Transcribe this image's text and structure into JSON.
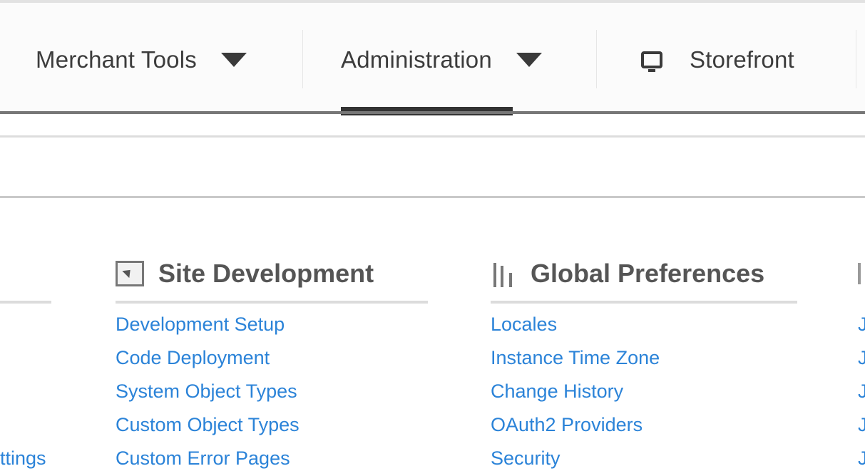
{
  "topnav": {
    "items": [
      {
        "label": "Merchant Tools"
      },
      {
        "label": "Administration"
      },
      {
        "label": "Storefront"
      }
    ]
  },
  "sections": {
    "left_partial": {
      "links": [
        "ttings"
      ]
    },
    "site_development": {
      "title": "Site Development",
      "links": [
        "Development Setup",
        "Code Deployment",
        "System Object Types",
        "Custom Object Types",
        "Custom Error Pages"
      ]
    },
    "global_preferences": {
      "title": "Global Preferences",
      "links": [
        "Locales",
        "Instance Time Zone",
        "Change History",
        "OAuth2 Providers",
        "Security"
      ]
    },
    "right_partial": {
      "links": [
        "J",
        "J",
        "J",
        "J",
        "J"
      ]
    }
  },
  "colors": {
    "link": "#2b83d8",
    "nav_text": "#3c3c3c",
    "active_indicator": "#333333"
  }
}
